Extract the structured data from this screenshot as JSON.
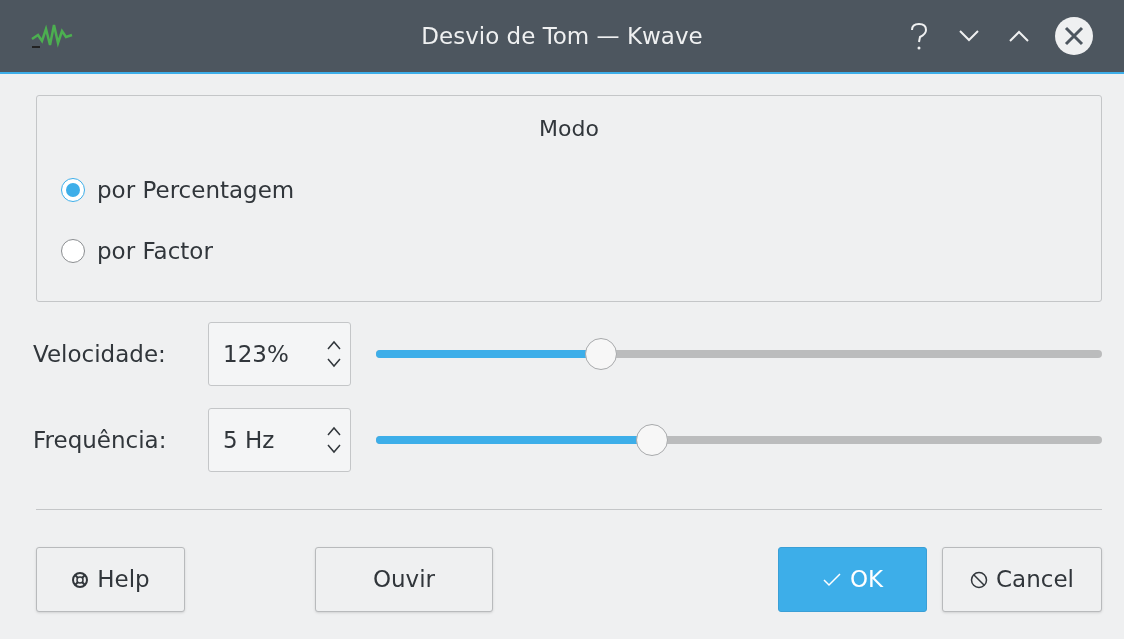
{
  "window": {
    "title": "Desvio de Tom — Kwave"
  },
  "mode": {
    "title": "Modo",
    "options": [
      {
        "label": "por Percentagem",
        "selected": true
      },
      {
        "label": "por Factor",
        "selected": false
      }
    ]
  },
  "params": [
    {
      "label": "Velocidade:",
      "value": "123%",
      "level": 0.31
    },
    {
      "label": "Frequência:",
      "value": "5 Hz",
      "level": 0.38
    }
  ],
  "buttons": [
    {
      "kind": "help",
      "label": "Help"
    },
    {
      "kind": "plain",
      "label": "Ouvir"
    },
    {
      "kind": "ok",
      "label": "OK"
    },
    {
      "kind": "cancel",
      "label": "Cancel"
    }
  ]
}
